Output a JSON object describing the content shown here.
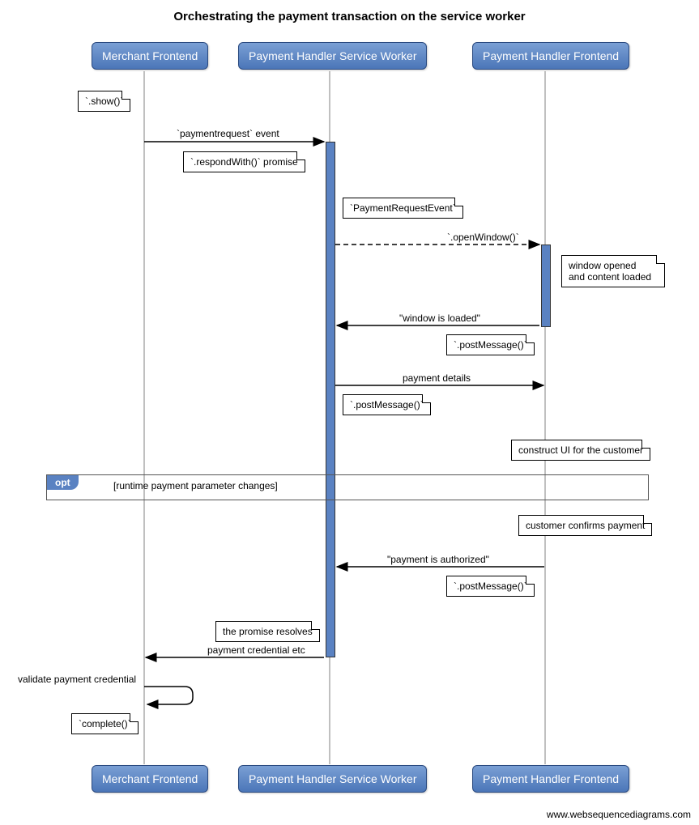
{
  "title": "Orchestrating the payment transaction on the service worker",
  "actors": {
    "merchant": "Merchant Frontend",
    "sw": "Payment Handler Service Worker",
    "frontend": "Payment Handler Frontend"
  },
  "notes": {
    "show": "`.show()`",
    "respondWith": "`.respondWith()` promise",
    "pre": "`PaymentRequestEvent`",
    "windowOpened": "window opened\nand content loaded",
    "postMsg1": "`.postMessage()`",
    "postMsg2": "`.postMessage()`",
    "constructUI": "construct UI for the customer",
    "customerConfirms": "customer confirms payment",
    "postMsg3": "`.postMessage()`",
    "promiseResolves": "the promise resolves",
    "complete": "`complete()`"
  },
  "messages": {
    "paymentrequest": "`paymentrequest` event",
    "openWindow": "`.openWindow()`",
    "windowLoaded": "\"window is loaded\"",
    "paymentDetails": "payment details",
    "paymentAuthorized": "\"payment is authorized\"",
    "paymentCredential": "payment credential etc",
    "validate": "validate payment credential"
  },
  "opt": {
    "label": "opt",
    "guard": "[runtime payment parameter changes]"
  },
  "watermark": "www.websequencediagrams.com"
}
